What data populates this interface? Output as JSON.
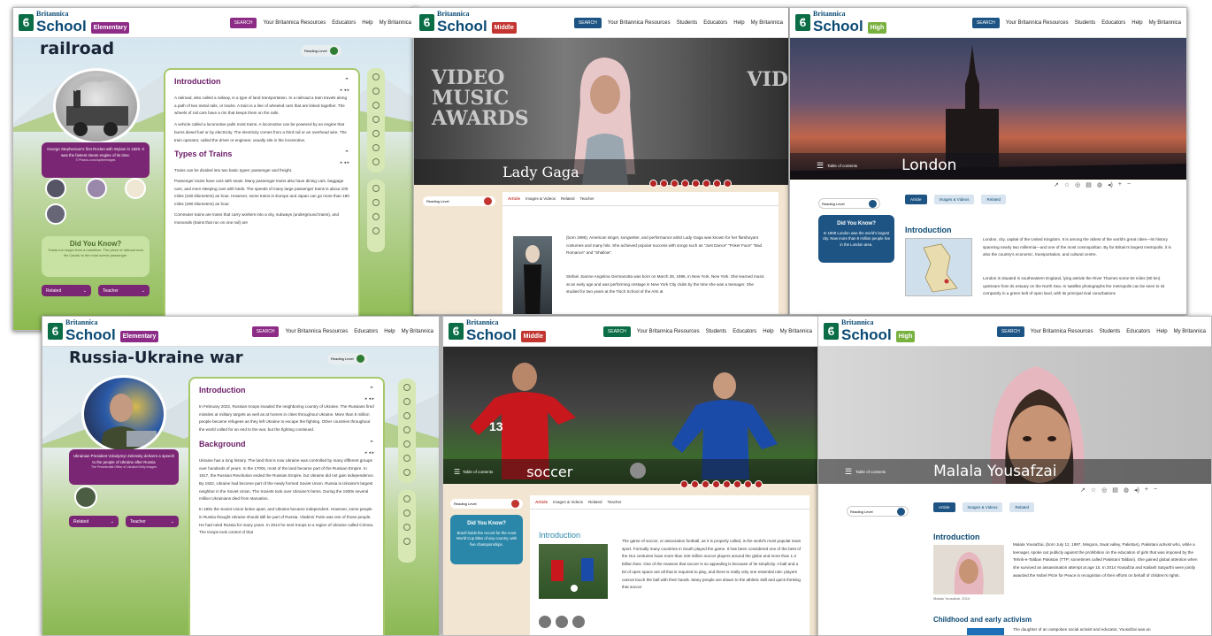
{
  "screens": [
    {
      "level": "Elementary",
      "level_color": "#8c2c86",
      "search": "SEARCH",
      "search_color": "#8c2c86",
      "nav": [
        "Your Britannica Resources",
        "Educators",
        "Help",
        "My Britannica"
      ],
      "title": "railroad",
      "reading_level": "Reading Level",
      "caption": "George Stephenson's first Rocket with Wylam in 1829. It was the fastest steam engine of its time.",
      "caption_credit": "© Photos.com/Jupiterimages",
      "sections": [
        {
          "heading": "Introduction",
          "paras": [
            "A railroad, also called a railway, is a type of land transportation. In a railroad a train travels along a path of two metal rails, or tracks. A train is a line of wheeled cars that are linked together. The wheels of rail cars have a rim that keeps them on the rails.",
            "A vehicle called a locomotive pulls most trains. A locomotive can be powered by an engine that burns diesel fuel or by electricity. The electricity comes from a third rail or an overhead wire. The train operator, called the driver or engineer, usually sits in the locomotive."
          ]
        },
        {
          "heading": "Types of Trains",
          "paras": [
            "Trains can be divided into two basic types: passenger and freight.",
            "Passenger trains have cars with seats. Many passenger trains also have dining cars, baggage cars, and even sleeping cars with beds. The speeds of many large passenger trains is about 100 miles (160 kilometers) an hour. However, some trains in Europe and Japan can go more than 180 miles (290 kilometers) an hour.",
            "Commuter trains are trains that carry workers into a city, subways (underground trains), and monorails (trains that run on one rail) are"
          ]
        }
      ],
      "dyk_title": "Did You Know?",
      "dyk_text": "Trains run longer than a marathon. The piece of railroad near Iris Cavalo is the most scenic passenger.",
      "related": "Related",
      "teacher": "Teacher"
    },
    {
      "level": "Middle",
      "level_color": "#c23530",
      "search": "SEARCH",
      "search_color": "#1d5483",
      "nav": [
        "Your Britannica Resources",
        "Students",
        "Educators",
        "Help",
        "My Britannica"
      ],
      "title": "Lady Gaga",
      "banner_lines": [
        "VIDEO",
        "MUSIC",
        "AWARDS"
      ],
      "banner_right": "VID",
      "tabs": [
        "Article",
        "Images & Videos",
        "Related",
        "Teacher"
      ],
      "reading_level": "Reading Level",
      "paras": [
        "(born 1986), American singer, songwriter, and performance artist Lady Gaga was known for her flamboyant costumes and many hits. She achieved popular success with songs such as \"Just Dance\" \"Poker Face\" \"Bad Romance\" and \"Shallow\".",
        "Stefani Joanne Angelina Germanotta was born on March 28, 1986, in New York, New York. She learned music at an early age and was performing onstage in New York City clubs by the time she was a teenager. She studied for two years at the Tisch School of the Arts at"
      ]
    },
    {
      "level": "High",
      "level_color": "#79b13f",
      "search": "SEARCH",
      "search_color": "#1d5483",
      "nav": [
        "Your Britannica Resources",
        "Students",
        "Educators",
        "Help",
        "My Britannica"
      ],
      "title": "London",
      "toc": "Table of contents",
      "reading_level": "Reading Level",
      "tabs": [
        "Article",
        "Images & Videos",
        "Related"
      ],
      "dyk_title": "Did You Know?",
      "dyk_text": "In 1908 London was the world's largest city. Now more than 8 million people live in the London area.",
      "section": "Introduction",
      "paras": [
        "London, city, capital of the United Kingdom. It is among the oldest of the world's great cities—its history spanning nearly two millennia—and one of the most cosmopolitan. By far Britain's largest metropolis, it is also the country's economic, transportation, and cultural centre.",
        "London is situated in southeastern England, lying astride the River Thames some 50 miles (80 km) upstream from its estuary on the North Sea. In satellite photographs the metropolis can be seen to sit compactly in a green belt of open land, with its principal rival conurbations"
      ]
    },
    {
      "level": "Elementary",
      "level_color": "#8c2c86",
      "search": "SEARCH",
      "search_color": "#8c2c86",
      "nav": [
        "Your Britannica Resources",
        "Educators",
        "Help",
        "My Britannica"
      ],
      "title": "Russia-Ukraine war",
      "reading_level": "Reading Level",
      "caption": "Ukrainian President Volodymyr Zelensky delivers a speech to the people of Ukraine after Russia",
      "caption_credit": "The Presidential Office of Ukraine/Getty Images",
      "sections": [
        {
          "heading": "Introduction",
          "paras": [
            "In February 2022, Russian troops invaded the neighboring country of Ukraine. The Russians fired missiles at military targets as well as at homes in cities throughout Ukraine. More than 5 million people became refugees as they left Ukraine to escape the fighting. Other countries throughout the world called for an end to the war, but the fighting continued."
          ]
        },
        {
          "heading": "Background",
          "paras": [
            "Ukraine has a long history. The land that is now Ukraine was controlled by many different groups over hundreds of years. In the 1700s, most of the land became part of the Russian Empire. In 1917, the Russian Revolution ended the Russian Empire, but Ukraine did not gain independence. By 1922, Ukraine had become part of the newly formed Soviet Union. Russia is Ukraine's largest neighbor in the Soviet Union. The Soviets took over Ukraine's farms. During the 1930s several million Ukrainians died from starvation.",
            "In 1991 the Soviet Union broke apart, and Ukraine became independent. However, some people in Russia thought Ukraine should still be part of Russia. Vladimir Putin was one of those people. He had ruled Russia for many years. In 2014 he sent troops to a region of Ukraine called Crimea. The troops took control of that"
          ]
        }
      ],
      "related": "Related",
      "teacher": "Teacher"
    },
    {
      "level": "Middle",
      "level_color": "#c23530",
      "search": "SEARCH",
      "search_color": "#0a6d46",
      "nav": [
        "Your Britannica Resources",
        "Students",
        "Educators",
        "Help",
        "My Britannica"
      ],
      "title": "soccer",
      "toc": "Table of contents",
      "jersey": "13",
      "tabs": [
        "Article",
        "Images & Videos",
        "Related",
        "Teacher"
      ],
      "reading_level": "Reading Level",
      "dyk_title": "Did You Know?",
      "dyk_text": "Brazil holds the record for the most World Cup titles of any country, with five championships.",
      "section": "Introduction",
      "paras": [
        "The game of soccer, or association football, as it is properly called, is the world's most popular team sport. Formally many countries in South played the game. It has been considered one of the best of the Our centuries have more than 240 million soccer players around the globe and more than 1.3 billion fans. One of the reasons that soccer is so appealing is because of its simplicity. A ball and a bit of open space are all that is required to play, and there is really only one essential rule: players cannot touch the ball with their hands. Many people are drawn to the athletic skill and quick thinking that soccer"
      ]
    },
    {
      "level": "High",
      "level_color": "#79b13f",
      "search": "SEARCH",
      "search_color": "#1d5483",
      "nav": [
        "Your Britannica Resources",
        "Students",
        "Educators",
        "Help",
        "My Britannica"
      ],
      "title": "Malala Yousafzai",
      "toc": "Table of contents",
      "reading_level": "Reading Level",
      "tabs": [
        "Article",
        "Images & Videos",
        "Related"
      ],
      "section": "Introduction",
      "section2": "Childhood and early activism",
      "img_caption": "Malala Yousafzai, 2014",
      "paras": [
        "Malala Yousafzai, (born July 12, 1997, Mingora, Swat valley, Pakistan), Pakistani activist who, while a teenager, spoke out publicly against the prohibition on the education of girls that was imposed by the Tehrik-e-Taliban Pakistan (TTP; sometimes called Pakistani Taliban). She gained global attention when she survived an assassination attempt at age 15. In 2014 Yousafzai and Kailash Satyarthi were jointly awarded the Nobel Prize for Peace in recognition of their efforts on behalf of children's rights.",
        "The daughter of an outspoken social activist and educator, Yousafzai was an"
      ]
    }
  ]
}
